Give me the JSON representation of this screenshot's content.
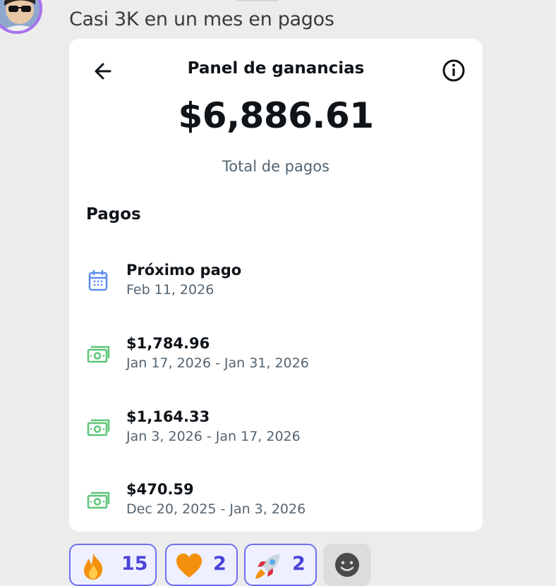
{
  "chat": {
    "message_text": "Casi 3K en un mes en pagos"
  },
  "card": {
    "title": "Panel de ganancias",
    "total_amount": "$6,886.61",
    "total_label": "Total de pagos",
    "section_title": "Pagos",
    "payments": [
      {
        "title": "Próximo pago",
        "subtitle": "Feb 11, 2026",
        "icon": "calendar-icon"
      },
      {
        "title": "$1,784.96",
        "subtitle": "Jan 17, 2026 - Jan 31, 2026",
        "icon": "cash-icon"
      },
      {
        "title": "$1,164.33",
        "subtitle": "Jan 3, 2026 - Jan 17, 2026",
        "icon": "cash-icon"
      },
      {
        "title": "$470.59",
        "subtitle": "Dec 20, 2025 - Jan 3, 2026",
        "icon": "cash-icon"
      }
    ]
  },
  "reactions": [
    {
      "emoji": "fire",
      "count": "15"
    },
    {
      "emoji": "orange-heart",
      "count": "2"
    },
    {
      "emoji": "rocket",
      "count": "2"
    }
  ],
  "colors": {
    "accent": "#6f6ef0",
    "calendar": "#5b8def",
    "cash": "#5cc677",
    "subtext": "#536471"
  }
}
